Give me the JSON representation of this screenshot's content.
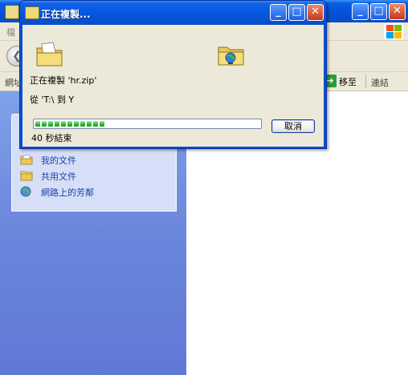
{
  "background_window": {
    "menubar": {
      "file_menu": "檔"
    },
    "addressbar": {
      "label": "網址",
      "go_label": "移至",
      "links_label": "連結"
    },
    "tasks": [
      {
        "label": "我的文件",
        "icon": "documents-icon"
      },
      {
        "label": "共用文件",
        "icon": "shared-folder-icon"
      },
      {
        "label": "網路上的芳鄰",
        "icon": "network-icon"
      }
    ]
  },
  "dialog": {
    "title": "正在複製...",
    "copying_line": "正在複製 'hr.zip'",
    "from_to_line": "從 'T:\\ 到 Y",
    "progress_fraction": 0.32,
    "cancel_label": "取消",
    "time_remaining": "40 秒結束"
  },
  "colors": {
    "titlebar_blue": "#0556df",
    "dialog_face": "#ece9d8",
    "progress_green": "#2fbf3a",
    "close_red": "#c8371a",
    "task_link": "#1c3fa8"
  }
}
